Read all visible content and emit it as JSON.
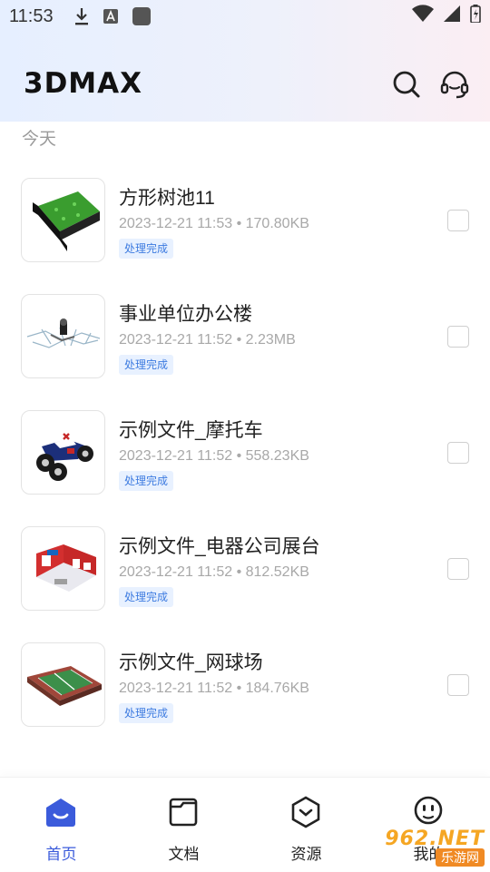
{
  "status_bar": {
    "time": "11:53",
    "icons": [
      "download-icon",
      "a-icon",
      "app-square-icon",
      "wifi-icon",
      "signal-icon",
      "battery-icon"
    ]
  },
  "header": {
    "logo": "3DMAX",
    "icons": [
      "search-icon",
      "headset-icon"
    ]
  },
  "section_label": "今天",
  "files": [
    {
      "title": "方形树池11",
      "meta": "2023-12-21 11:53 • 170.80KB",
      "status": "处理完成",
      "thumb_icon": "tree-pool-model-thumbnail"
    },
    {
      "title": "事业单位办公楼",
      "meta": "2023-12-21 11:52 • 2.23MB",
      "status": "处理完成",
      "thumb_icon": "office-building-model-thumbnail"
    },
    {
      "title": "示例文件_摩托车",
      "meta": "2023-12-21 11:52 • 558.23KB",
      "status": "处理完成",
      "thumb_icon": "atv-model-thumbnail"
    },
    {
      "title": "示例文件_电器公司展台",
      "meta": "2023-12-21 11:52 • 812.52KB",
      "status": "处理完成",
      "thumb_icon": "booth-model-thumbnail"
    },
    {
      "title": "示例文件_网球场",
      "meta": "2023-12-21 11:52 • 184.76KB",
      "status": "处理完成",
      "thumb_icon": "tennis-court-model-thumbnail"
    }
  ],
  "tabs": [
    {
      "label": "首页",
      "icon": "home-icon",
      "active": true
    },
    {
      "label": "文档",
      "icon": "folder-icon",
      "active": false
    },
    {
      "label": "资源",
      "icon": "resources-icon",
      "active": false
    },
    {
      "label": "我的",
      "icon": "smiley-icon",
      "active": false
    }
  ],
  "watermark": {
    "top": "962.NET",
    "bottom": "乐游网"
  },
  "colors": {
    "accent": "#3b5bdb",
    "badge_bg": "#e8f1ff",
    "badge_text": "#3d7be0"
  }
}
